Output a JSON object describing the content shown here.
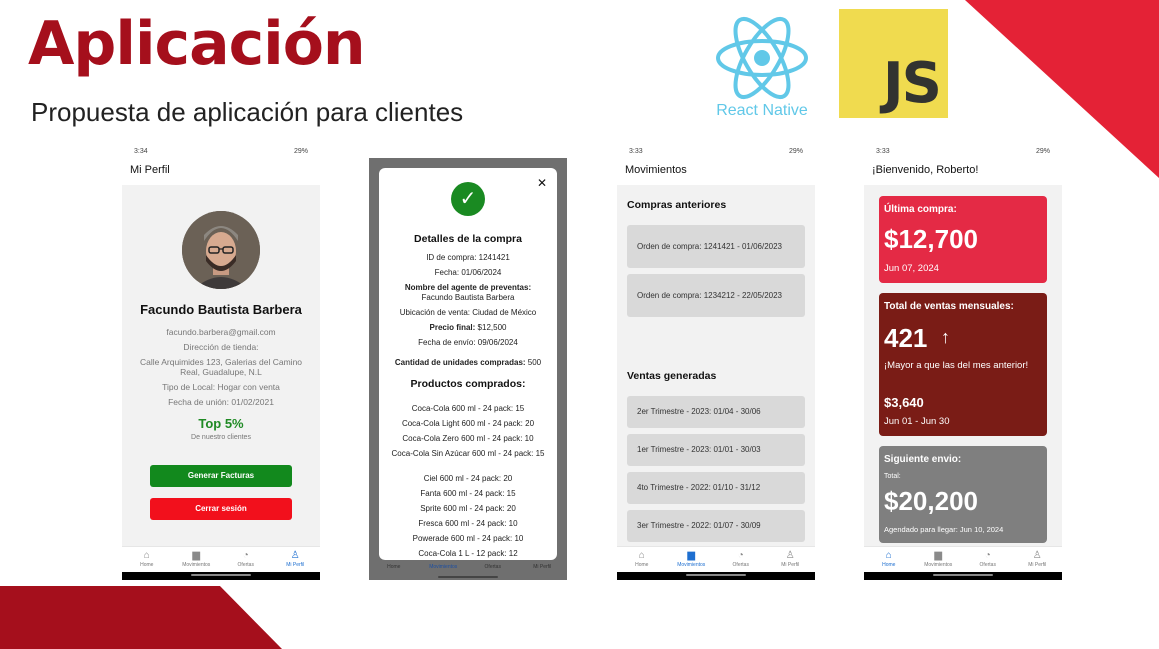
{
  "slide": {
    "title": "Aplicación",
    "subtitle": "Propuesta de aplicación para clientes",
    "react_label": "React Native",
    "js_label": "JS"
  },
  "colors": {
    "brand_red": "#a50f1c",
    "accent_red": "#e42236",
    "react_blue": "#61c8e8",
    "js_yellow": "#f0db4f",
    "tab_active": "#1e6fd0"
  },
  "tabs": [
    "Home",
    "Movimientos",
    "Ofertas",
    "Mi Perfil"
  ],
  "tab_icons": [
    "home-icon",
    "wallet-icon",
    "bell-icon",
    "person-icon"
  ],
  "phone1": {
    "time": "3:34",
    "battery": "29%",
    "title": "Mi Perfil",
    "name": "Facundo Bautista Barbera",
    "email": "facundo.barbera@gmail.com",
    "address_label": "Dirección de tienda:",
    "address": "Calle Arquimides 123, Galerias del Camino Real, Guadalupe, N.L",
    "store_type": "Tipo de Local: Hogar con venta",
    "join_date": "Fecha de unión: 01/02/2021",
    "rank": "Top 5%",
    "rank_sub": "De nuestro clientes",
    "btn_invoices": "Generar Facturas",
    "btn_logout": "Cerrar sesión"
  },
  "phone2": {
    "heading": "Detalles de la compra",
    "order_id": "ID de compra: 1241421",
    "date": "Fecha: 01/06/2024",
    "agent_label": "Nombre del agente de preventas:",
    "agent_name": "Facundo Bautista Barbera",
    "location": "Ubicación de venta: Ciudad de México",
    "price_label": "Precio final:",
    "price_value": " $12,500",
    "ship_date": "Fecha de envío: 09/06/2024",
    "units_label": "Cantidad de unidades compradas:",
    "units_value": " 500",
    "products_heading": "Productos comprados:",
    "products": [
      "Coca-Cola 600 ml - 24 pack: 15",
      "Coca-Cola Light 600 ml - 24 pack: 20",
      "Coca-Cola Zero 600 ml - 24 pack: 10",
      "Coca-Cola Sin Azúcar 600 ml - 24 pack: 15",
      "Ciel 600 ml - 24 pack: 20",
      "Fanta 600 ml - 24 pack: 15",
      "Sprite 600 ml - 24 pack: 20",
      "Fresca 600 ml - 24 pack: 10",
      "Powerade 600 ml - 24 pack: 10",
      "Coca-Cola 1 L - 12 pack: 12"
    ]
  },
  "phone3": {
    "time": "3:33",
    "battery": "29%",
    "title": "Movimientos",
    "previous_heading": "Compras anteriores",
    "previous": [
      "Orden de compra: 1241421 - 01/06/2023",
      "Orden de compra: 1234212 - 22/05/2023"
    ],
    "sales_heading": "Ventas generadas",
    "sales": [
      "2er Trimestre - 2023: 01/04 - 30/06",
      "1er Trimestre - 2023: 01/01 - 30/03",
      "4to Trimestre - 2022: 01/10 - 31/12",
      "3er Trimestre - 2022: 01/07 - 30/09"
    ]
  },
  "phone4": {
    "time": "3:33",
    "battery": "29%",
    "title": "¡Bienvenido, Roberto!",
    "last_label": "Última compra:",
    "last_amount": "$12,700",
    "last_date": "Jun 07, 2024",
    "monthly_label": "Total de ventas mensuales:",
    "monthly_count": "421",
    "monthly_note": "¡Mayor a que las del mes anterior!",
    "monthly_amount": "$3,640",
    "monthly_range": "Jun 01 - Jun 30",
    "next_label": "Siguiente envio:",
    "next_total_label": "Total:",
    "next_amount": "$20,200",
    "next_note": "Agendado para llegar: Jun 10, 2024"
  }
}
